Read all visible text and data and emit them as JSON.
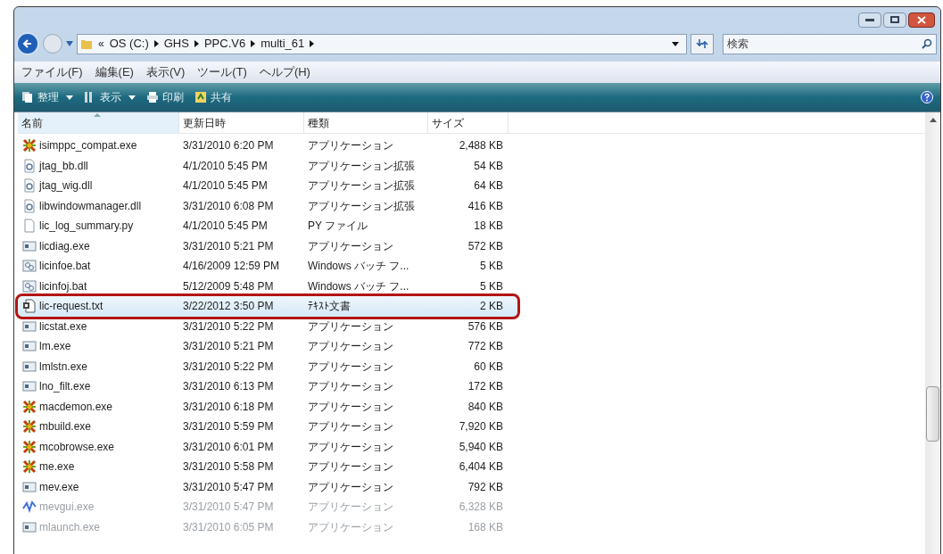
{
  "address": {
    "overflow": "«",
    "crumbs": [
      "OS (C:)",
      "GHS",
      "PPC.V6",
      "multi_61"
    ]
  },
  "search": {
    "placeholder": "検索"
  },
  "menu": [
    "ファイル(F)",
    "編集(E)",
    "表示(V)",
    "ツール(T)",
    "ヘルプ(H)"
  ],
  "toolbar": [
    {
      "label": "整理",
      "kind": "organize",
      "dropdown": true
    },
    {
      "label": "表示",
      "kind": "views",
      "dropdown": true
    },
    {
      "label": "印刷",
      "kind": "print",
      "dropdown": false
    },
    {
      "label": "共有",
      "kind": "share",
      "dropdown": false
    }
  ],
  "columns": [
    {
      "label": "名前",
      "sorted": true
    },
    {
      "label": "更新日時",
      "sorted": false
    },
    {
      "label": "種類",
      "sorted": false
    },
    {
      "label": "サイズ",
      "sorted": false
    }
  ],
  "rows": [
    {
      "name": "isimppc_compat.exe",
      "date": "3/31/2010 6:20 PM",
      "type": "アプリケーション",
      "size": "2,488 KB",
      "kind": "star",
      "selected": false,
      "highlighted": false,
      "faded": false
    },
    {
      "name": "jtag_bb.dll",
      "date": "4/1/2010 5:45 PM",
      "type": "アプリケーション拡張",
      "size": "54 KB",
      "kind": "dll",
      "selected": false,
      "highlighted": false,
      "faded": false
    },
    {
      "name": "jtag_wig.dll",
      "date": "4/1/2010 5:45 PM",
      "type": "アプリケーション拡張",
      "size": "64 KB",
      "kind": "dll",
      "selected": false,
      "highlighted": false,
      "faded": false
    },
    {
      "name": "libwindowmanager.dll",
      "date": "3/31/2010 6:08 PM",
      "type": "アプリケーション拡張",
      "size": "416 KB",
      "kind": "dll",
      "selected": false,
      "highlighted": false,
      "faded": false
    },
    {
      "name": "lic_log_summary.py",
      "date": "4/1/2010 5:45 PM",
      "type": "PY ファイル",
      "size": "18 KB",
      "kind": "file",
      "selected": false,
      "highlighted": false,
      "faded": false
    },
    {
      "name": "licdiag.exe",
      "date": "3/31/2010 5:21 PM",
      "type": "アプリケーション",
      "size": "572 KB",
      "kind": "exe",
      "selected": false,
      "highlighted": false,
      "faded": false
    },
    {
      "name": "licinfoe.bat",
      "date": "4/16/2009 12:59 PM",
      "type": "Windows バッチ フ...",
      "size": "5 KB",
      "kind": "bat",
      "selected": false,
      "highlighted": false,
      "faded": false
    },
    {
      "name": "licinfoj.bat",
      "date": "5/12/2009 5:48 PM",
      "type": "Windows バッチ フ...",
      "size": "5 KB",
      "kind": "bat",
      "selected": false,
      "highlighted": false,
      "faded": false
    },
    {
      "name": "lic-request.txt",
      "date": "3/22/2012 3:50 PM",
      "type": "ﾃｷｽﾄ文書",
      "size": "2 KB",
      "kind": "txt",
      "selected": true,
      "highlighted": true,
      "faded": false
    },
    {
      "name": "licstat.exe",
      "date": "3/31/2010 5:22 PM",
      "type": "アプリケーション",
      "size": "576 KB",
      "kind": "exe",
      "selected": false,
      "highlighted": false,
      "faded": false
    },
    {
      "name": "lm.exe",
      "date": "3/31/2010 5:21 PM",
      "type": "アプリケーション",
      "size": "772 KB",
      "kind": "exe",
      "selected": false,
      "highlighted": false,
      "faded": false
    },
    {
      "name": "lmlstn.exe",
      "date": "3/31/2010 5:22 PM",
      "type": "アプリケーション",
      "size": "60 KB",
      "kind": "exe",
      "selected": false,
      "highlighted": false,
      "faded": false
    },
    {
      "name": "lno_filt.exe",
      "date": "3/31/2010 6:13 PM",
      "type": "アプリケーション",
      "size": "172 KB",
      "kind": "exe",
      "selected": false,
      "highlighted": false,
      "faded": false
    },
    {
      "name": "macdemon.exe",
      "date": "3/31/2010 6:18 PM",
      "type": "アプリケーション",
      "size": "840 KB",
      "kind": "star",
      "selected": false,
      "highlighted": false,
      "faded": false
    },
    {
      "name": "mbuild.exe",
      "date": "3/31/2010 5:59 PM",
      "type": "アプリケーション",
      "size": "7,920 KB",
      "kind": "star",
      "selected": false,
      "highlighted": false,
      "faded": false
    },
    {
      "name": "mcobrowse.exe",
      "date": "3/31/2010 6:01 PM",
      "type": "アプリケーション",
      "size": "5,940 KB",
      "kind": "star",
      "selected": false,
      "highlighted": false,
      "faded": false
    },
    {
      "name": "me.exe",
      "date": "3/31/2010 5:58 PM",
      "type": "アプリケーション",
      "size": "6,404 KB",
      "kind": "star",
      "selected": false,
      "highlighted": false,
      "faded": false
    },
    {
      "name": "mev.exe",
      "date": "3/31/2010 5:47 PM",
      "type": "アプリケーション",
      "size": "792 KB",
      "kind": "exe",
      "selected": false,
      "highlighted": false,
      "faded": false
    },
    {
      "name": "mevgui.exe",
      "date": "3/31/2010 5:47 PM",
      "type": "アプリケーション",
      "size": "6,328 KB",
      "kind": "wave",
      "selected": false,
      "highlighted": false,
      "faded": true
    },
    {
      "name": "mlaunch.exe",
      "date": "3/31/2010 6:05 PM",
      "type": "アプリケーション",
      "size": "168 KB",
      "kind": "exe",
      "selected": false,
      "highlighted": false,
      "faded": true
    }
  ]
}
